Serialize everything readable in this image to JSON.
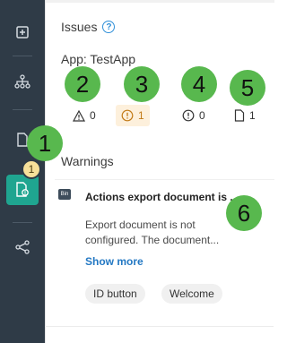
{
  "rail": {
    "badge_count": "1",
    "items": [
      {
        "icon": "add-page-icon"
      },
      {
        "icon": "sitemap-icon"
      },
      {
        "icon": "document-icon"
      },
      {
        "icon": "document-issues-icon"
      },
      {
        "icon": "share-icon"
      }
    ]
  },
  "issues": {
    "title": "Issues",
    "help_icon": "?",
    "app_label": "App: TestApp"
  },
  "counters": [
    {
      "icon": "warning-triangle-icon",
      "count": "0"
    },
    {
      "icon": "exclamation-circle-icon",
      "count": "1"
    },
    {
      "icon": "info-circle-icon",
      "count": "0"
    },
    {
      "icon": "document-icon",
      "count": "1"
    }
  ],
  "callouts": [
    "1",
    "2",
    "3",
    "4",
    "5",
    "6"
  ],
  "warnings": {
    "title": "Warnings",
    "card": {
      "type_icon_label": "Bin",
      "title": "Actions export document is ...",
      "body": "Export document is not configured. The document...",
      "show_more": "Show more",
      "tags": [
        "ID button",
        "Welcome"
      ]
    }
  },
  "colors": {
    "rail_bg": "#2f3b47",
    "rail_active": "#1fa590",
    "callout": "#58b84e",
    "link": "#2378c3",
    "warning_highlight": "#fdf0dc"
  }
}
